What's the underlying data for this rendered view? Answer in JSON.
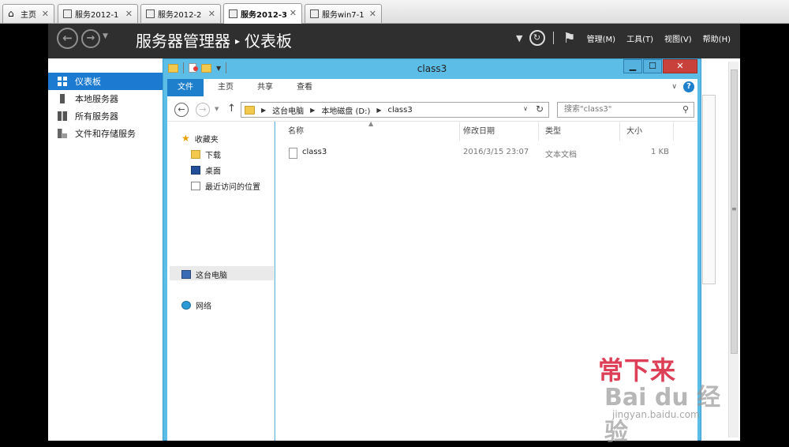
{
  "vm_tabs": [
    {
      "label": "主页"
    },
    {
      "label": "服务2012-1"
    },
    {
      "label": "服务2012-2"
    },
    {
      "label": "服务2012-3"
    },
    {
      "label": "服务win7-1"
    }
  ],
  "server_manager": {
    "title": "服务器管理器",
    "page": "仪表板",
    "menus": [
      "管理(M)",
      "工具(T)",
      "视图(V)",
      "帮助(H)"
    ],
    "sidebar": [
      {
        "label": "仪表板"
      },
      {
        "label": "本地服务器"
      },
      {
        "label": "所有服务器"
      },
      {
        "label": "文件和存储服务"
      }
    ]
  },
  "explorer": {
    "title": "class3",
    "ribbon_tabs": [
      "文件",
      "主页",
      "共享",
      "查看"
    ],
    "breadcrumb": [
      "这台电脑",
      "本地磁盘 (D:)",
      "class3"
    ],
    "search_placeholder": "搜索\"class3\"",
    "nav": {
      "favorites": "收藏夹",
      "downloads": "下载",
      "desktop": "桌面",
      "recent": "最近访问的位置",
      "this_pc": "这台电脑",
      "network": "网络"
    },
    "columns": [
      "名称",
      "修改日期",
      "类型",
      "大小"
    ],
    "files": [
      {
        "name": "class3",
        "modified": "2016/3/15 23:07",
        "type": "文本文档",
        "size": "1 KB"
      }
    ]
  },
  "watermark": {
    "line1": "常下来",
    "line2": "Bai du 经验",
    "url": "jingyan.baidu.com"
  }
}
